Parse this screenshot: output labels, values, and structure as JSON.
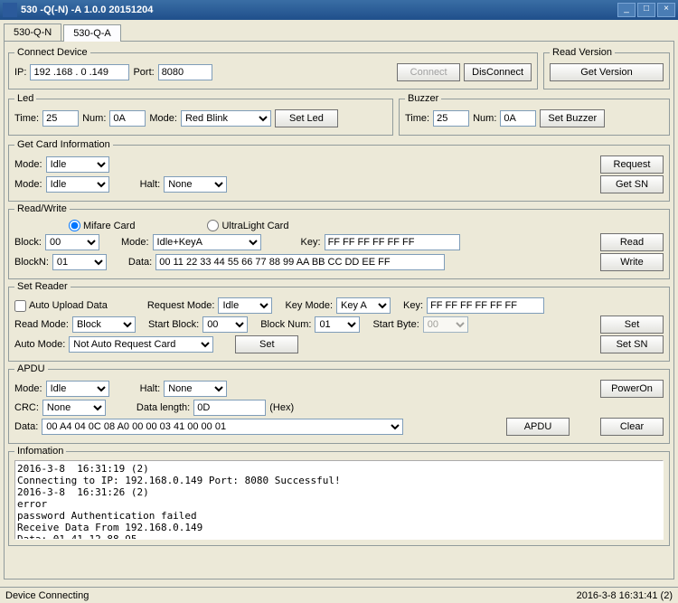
{
  "window": {
    "title": "530 -Q(-N) -A 1.0.0 20151204"
  },
  "tabs": {
    "t0": "530-Q-N",
    "t1": "530-Q-A"
  },
  "connect": {
    "legend": "Connect Device",
    "ip_label": "IP:",
    "ip": "192 .168 . 0 .149",
    "port_label": "Port:",
    "port": "8080",
    "connect_btn": "Connect",
    "disconnect_btn": "DisConnect"
  },
  "readver": {
    "legend": "Read Version",
    "btn": "Get Version"
  },
  "led": {
    "legend": "Led",
    "time_label": "Time:",
    "time": "25",
    "num_label": "Num:",
    "num": "0A",
    "mode_label": "Mode:",
    "mode": "Red Blink",
    "btn": "Set Led"
  },
  "buzzer": {
    "legend": "Buzzer",
    "time_label": "Time:",
    "time": "25",
    "num_label": "Num:",
    "num": "0A",
    "btn": "Set Buzzer"
  },
  "getcard": {
    "legend": "Get Card Information",
    "mode_label": "Mode:",
    "mode1": "Idle",
    "mode2": "Idle",
    "halt_label": "Halt:",
    "halt": "None",
    "req_btn": "Request",
    "sn_btn": "Get SN"
  },
  "rw": {
    "legend": "Read/Write",
    "mifare": "Mifare Card",
    "ultra": "UltraLight Card",
    "block_label": "Block:",
    "block": "00",
    "mode_label": "Mode:",
    "mode": "Idle+KeyA",
    "key_label": "Key:",
    "key": "FF FF FF FF FF FF",
    "read_btn": "Read",
    "blockn_label": "BlockN:",
    "blockn": "01",
    "data_label": "Data:",
    "data": "00 11 22 33 44 55 66 77 88 99 AA BB CC DD EE FF",
    "write_btn": "Write"
  },
  "setreader": {
    "legend": "Set Reader",
    "auto_upload": "Auto Upload Data",
    "reqmode_label": "Request Mode:",
    "reqmode": "Idle",
    "keymode_label": "Key Mode:",
    "keymode": "Key A",
    "key_label": "Key:",
    "key": "FF FF FF FF FF FF",
    "readmode_label": "Read Mode:",
    "readmode": "Block",
    "startblock_label": "Start Block:",
    "startblock": "00",
    "blocknum_label": "Block Num:",
    "blocknum": "01",
    "startbyte_label": "Start Byte:",
    "startbyte": "00",
    "set_btn": "Set",
    "automode_label": "Auto Mode:",
    "automode": "Not Auto Request Card",
    "set2_btn": "Set",
    "setsn_btn": "Set SN"
  },
  "apdu": {
    "legend": "APDU",
    "mode_label": "Mode:",
    "mode": "Idle",
    "halt_label": "Halt:",
    "halt": "None",
    "poweron_btn": "PowerOn",
    "crc_label": "CRC:",
    "crc": "None",
    "datalen_label": "Data length:",
    "datalen": "0D",
    "hex": "(Hex)",
    "data_label": "Data:",
    "data": "00 A4 04 0C 08 A0 00 00 03 41 00 00 01",
    "apdu_btn": "APDU",
    "clear_btn": "Clear"
  },
  "info": {
    "legend": "Infomation",
    "text": "2016-3-8  16:31:19 (2)\nConnecting to IP: 192.168.0.149 Port: 8080 Successful!\n2016-3-8  16:31:26 (2)\nerror\npassword Authentication failed\nReceive Data From 192.168.0.149\nData: 01 41 12 88 95"
  },
  "status": {
    "left": "Device Connecting",
    "right": "2016-3-8  16:31:41 (2)"
  }
}
